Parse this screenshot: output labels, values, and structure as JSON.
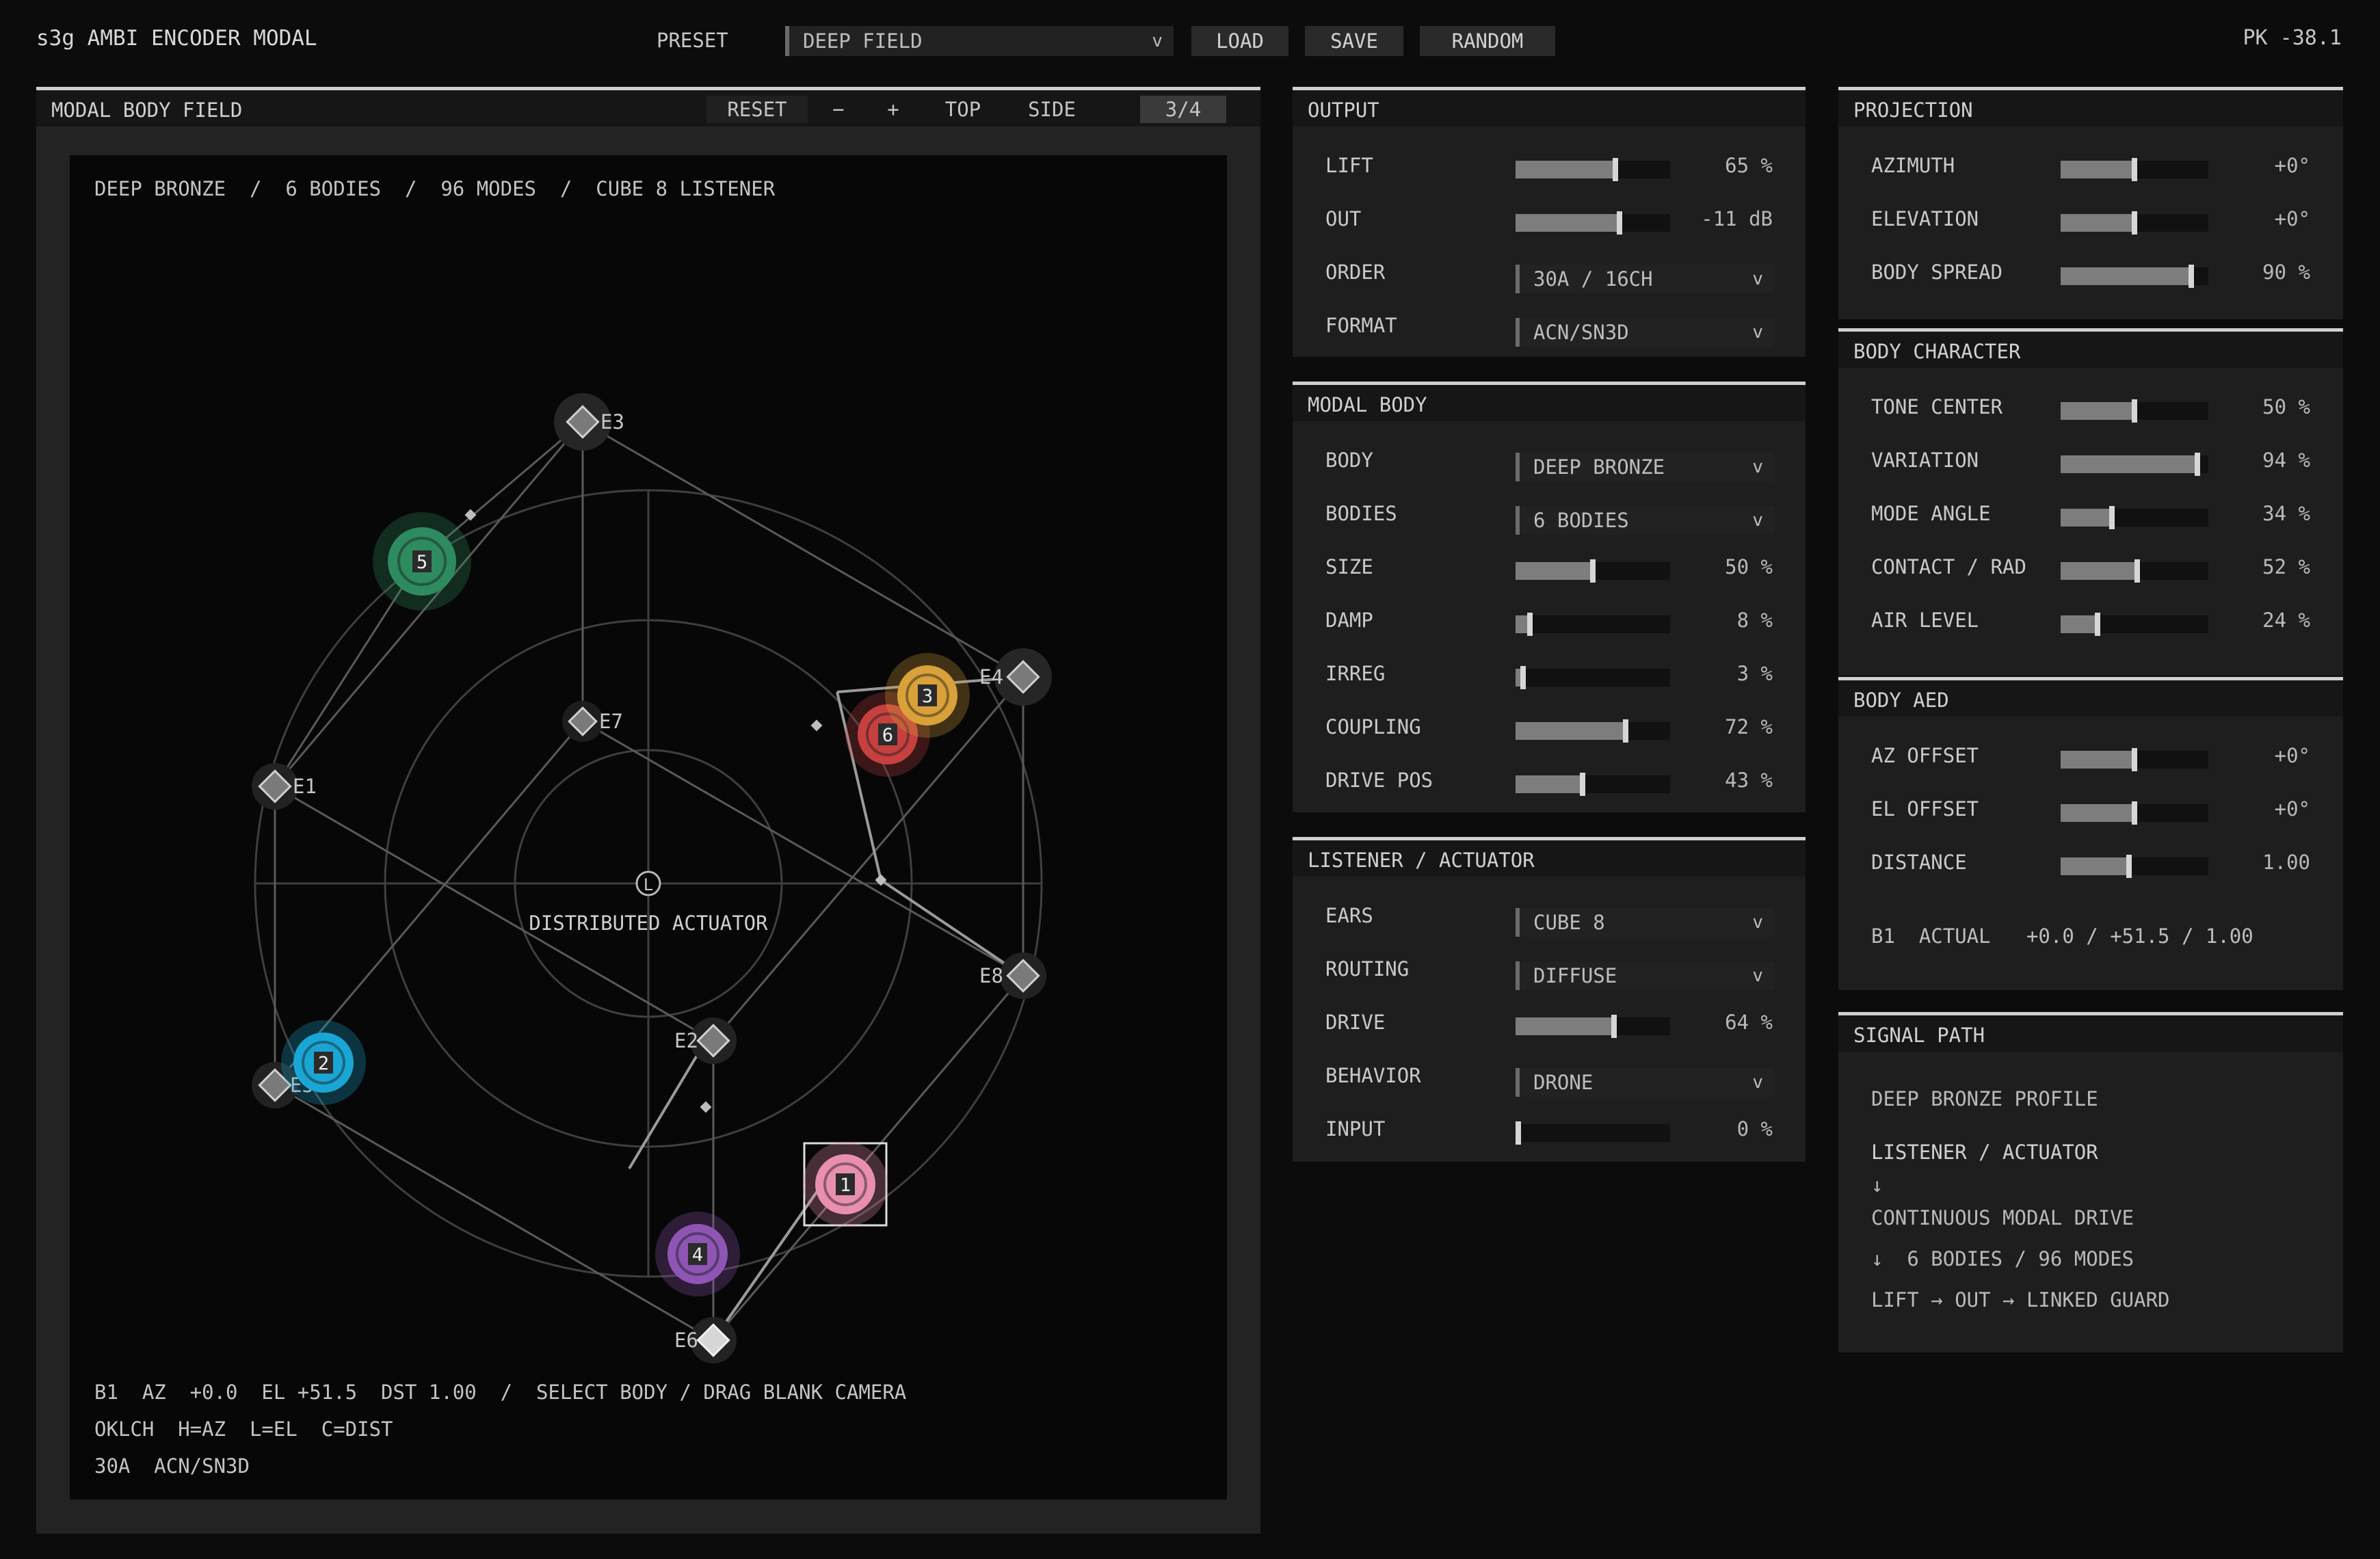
{
  "topbar": {
    "app_title": "s3g AMBI ENCODER MODAL",
    "preset_label": "PRESET",
    "preset_value": "DEEP FIELD",
    "load": "LOAD",
    "save": "SAVE",
    "random": "RANDOM",
    "peak": "PK -38.1"
  },
  "field": {
    "title": "MODAL BODY FIELD",
    "reset": "RESET",
    "zoom_out": "−",
    "zoom_in": "+",
    "top": "TOP",
    "side": "SIDE",
    "view": "3/4",
    "info_line": "DEEP BRONZE  /  6 BODIES  /  96 MODES  /  CUBE 8 LISTENER",
    "center_label": "DISTRIBUTED ACTUATOR",
    "listener_glyph": "L",
    "status_line1": "B1  AZ  +0.0  EL +51.5  DST 1.00  /  SELECT BODY / DRAG BLANK CAMERA",
    "status_line2": "OKLCH  H=AZ  L=EL  C=DIST",
    "status_line3": "30A  ACN/SN3D",
    "ears": [
      {
        "label": "E1"
      },
      {
        "label": "E2"
      },
      {
        "label": "E3"
      },
      {
        "label": "E4"
      },
      {
        "label": "E5"
      },
      {
        "label": "E6"
      },
      {
        "label": "E7"
      },
      {
        "label": "E8"
      }
    ],
    "bodies": [
      {
        "label": "1",
        "color": "#e88fb0"
      },
      {
        "label": "2",
        "color": "#1aa6d4"
      },
      {
        "label": "3",
        "color": "#d9a13a"
      },
      {
        "label": "4",
        "color": "#8e55b5"
      },
      {
        "label": "5",
        "color": "#2e8b5f"
      },
      {
        "label": "6",
        "color": "#c6403f"
      }
    ]
  },
  "output": {
    "title": "OUTPUT",
    "lift": {
      "label": "LIFT",
      "value": "65 %",
      "level": 0.65
    },
    "out": {
      "label": "OUT",
      "value": "-11 dB",
      "level": 0.68
    },
    "order": {
      "label": "ORDER",
      "value": "30A / 16CH"
    },
    "format": {
      "label": "FORMAT",
      "value": "ACN/SN3D"
    }
  },
  "modal_body": {
    "title": "MODAL BODY",
    "body": {
      "label": "BODY",
      "value": "DEEP BRONZE"
    },
    "bodies": {
      "label": "BODIES",
      "value": "6 BODIES"
    },
    "size": {
      "label": "SIZE",
      "value": "50 %",
      "level": 0.5
    },
    "damp": {
      "label": "DAMP",
      "value": "8 %",
      "level": 0.08
    },
    "irreg": {
      "label": "IRREG",
      "value": "3 %",
      "level": 0.03
    },
    "coupling": {
      "label": "COUPLING",
      "value": "72 %",
      "level": 0.72
    },
    "drive_pos": {
      "label": "DRIVE POS",
      "value": "43 %",
      "level": 0.43
    }
  },
  "listener": {
    "title": "LISTENER / ACTUATOR",
    "ears": {
      "label": "EARS",
      "value": "CUBE 8"
    },
    "routing": {
      "label": "ROUTING",
      "value": "DIFFUSE"
    },
    "drive": {
      "label": "DRIVE",
      "value": "64 %",
      "level": 0.64
    },
    "behavior": {
      "label": "BEHAVIOR",
      "value": "DRONE"
    },
    "input": {
      "label": "INPUT",
      "value": "0 %",
      "level": 0.0
    }
  },
  "projection": {
    "title": "PROJECTION",
    "azimuth": {
      "label": "AZIMUTH",
      "value": "+0°",
      "level": 0.5
    },
    "elevation": {
      "label": "ELEVATION",
      "value": "+0°",
      "level": 0.5
    },
    "body_spread": {
      "label": "BODY SPREAD",
      "value": "90 %",
      "level": 0.9
    }
  },
  "body_character": {
    "title": "BODY CHARACTER",
    "tone_center": {
      "label": "TONE CENTER",
      "value": "50 %",
      "level": 0.5
    },
    "variation": {
      "label": "VARIATION",
      "value": "94 %",
      "level": 0.94
    },
    "mode_angle": {
      "label": "MODE ANGLE",
      "value": "34 %",
      "level": 0.34
    },
    "contact_rad": {
      "label": "CONTACT / RAD",
      "value": "52 %",
      "level": 0.52
    },
    "air_level": {
      "label": "AIR LEVEL",
      "value": "24 %",
      "level": 0.24
    }
  },
  "body_aed": {
    "title": "BODY AED",
    "az_offset": {
      "label": "AZ OFFSET",
      "value": "+0°",
      "level": 0.5
    },
    "el_offset": {
      "label": "EL OFFSET",
      "value": "+0°",
      "level": 0.5
    },
    "distance": {
      "label": "DISTANCE",
      "value": "1.00",
      "level": 0.46
    },
    "actual": "B1  ACTUAL   +0.0 / +51.5 / 1.00"
  },
  "signal_path": {
    "title": "SIGNAL PATH",
    "line1": "DEEP BRONZE PROFILE",
    "line2": "LISTENER / ACTUATOR",
    "line3": "↓",
    "line4": "CONTINUOUS MODAL DRIVE",
    "line5": "↓  6 BODIES / 96 MODES",
    "line6": "LIFT → OUT → LINKED GUARD"
  }
}
